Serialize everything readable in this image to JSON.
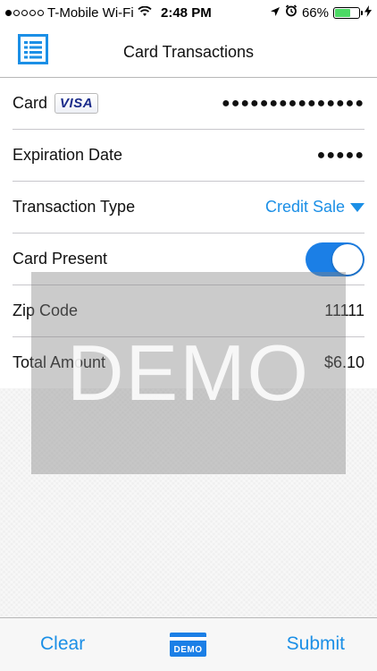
{
  "status_bar": {
    "carrier": "T-Mobile Wi-Fi",
    "time": "2:48 PM",
    "battery": "66%",
    "battery_level": 0.66,
    "signal_bars_filled": 1,
    "signal_bars_total": 5,
    "icons": [
      "wifi-icon",
      "location-arrow-icon",
      "alarm-clock-icon",
      "battery-icon",
      "charging-bolt-icon"
    ]
  },
  "nav": {
    "title": "Card Transactions",
    "menu_icon": "list-menu-icon"
  },
  "form": {
    "card": {
      "label": "Card",
      "brand": "VISA",
      "value": "●●●●●●●●●●●●●●●"
    },
    "expiration": {
      "label": "Expiration Date",
      "value": "●●●●●"
    },
    "transaction_type": {
      "label": "Transaction Type",
      "value": "Credit Sale"
    },
    "card_present": {
      "label": "Card Present",
      "on": true
    },
    "zip_code": {
      "label": "Zip Code",
      "value": "11111"
    },
    "total_amount": {
      "label": "Total Amount",
      "value": "$6.10"
    }
  },
  "overlay": {
    "text": "DEMO"
  },
  "toolbar": {
    "clear_label": "Clear",
    "card_label": "DEMO",
    "submit_label": "Submit"
  },
  "colors": {
    "accent": "#1b8fe6",
    "toggle_on": "#1b7fe6",
    "battery_fill": "#4cd964"
  }
}
